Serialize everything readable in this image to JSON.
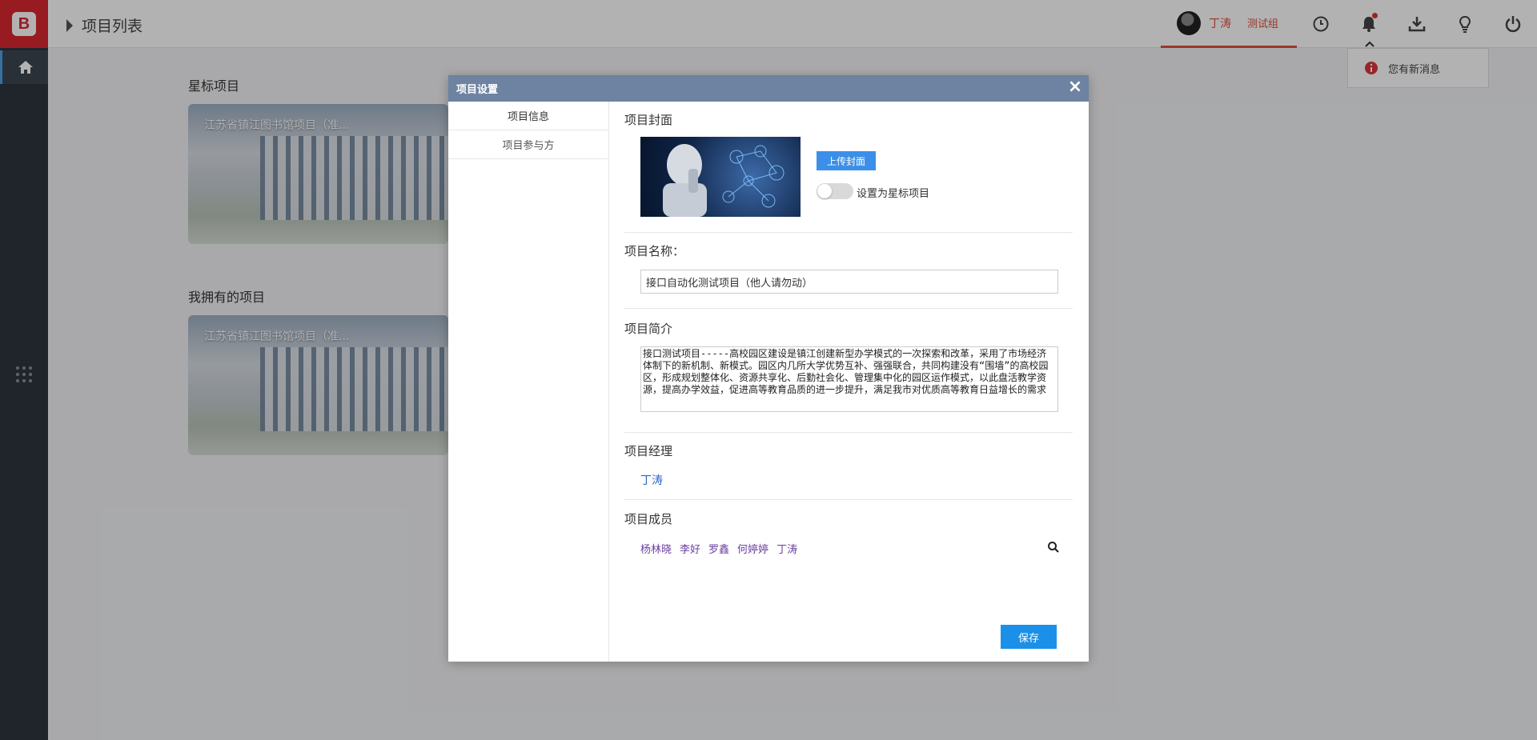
{
  "app": {
    "breadcrumb": "项目列表",
    "user": {
      "name": "丁涛",
      "group": "测试组"
    },
    "notification": {
      "text": "您有新消息"
    },
    "accent_color": "#e04d3c"
  },
  "main": {
    "starred_title": "星标项目",
    "owned_title": "我拥有的项目",
    "starred_card_title": "江苏省镇江图书馆项目（准...",
    "owned_card_title": "江苏省镇江图书馆项目（准..."
  },
  "modal": {
    "title": "项目设置",
    "close": "×",
    "tabs": [
      {
        "label": "项目信息"
      },
      {
        "label": "项目参与方"
      }
    ],
    "cover_label": "项目封面",
    "upload_label": "上传封面",
    "star_toggle_label": "设置为星标项目",
    "name_label": "项目名称：",
    "name_value": "接口自动化测试项目（他人请勿动）",
    "desc_label": "项目简介",
    "desc_value": "接口测试项目-----高校园区建设是镇江创建新型办学模式的一次探索和改革，采用了市场经济体制下的新机制、新模式。园区内几所大学优势互补、强强联合，共同构建没有“围墙”的高校园区，形成规划整体化、资源共享化、后勤社会化、管理集中化的园区运作模式，以此盘活教学资源，提高办学效益，促进高等教育品质的进一步提升，满足我市对优质高等教育日益增长的需求",
    "manager_label": "项目经理",
    "manager_value": "丁涛",
    "members_label": "项目成员",
    "members": [
      "杨林晓",
      "李好",
      "罗鑫",
      "何婷婷",
      "丁涛"
    ],
    "save_label": "保存"
  }
}
